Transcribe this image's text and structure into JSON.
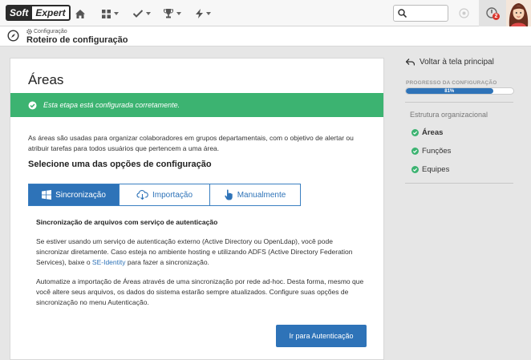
{
  "topbar": {
    "logo_part1": "Soft",
    "logo_part2": "Expert",
    "nav_icons": [
      "home-icon",
      "grid-icon",
      "check-icon",
      "trophy-icon",
      "bolt-icon"
    ],
    "notification_count": "2"
  },
  "subheader": {
    "breadcrumb": "Configuração",
    "title": "Roteiro de configuração"
  },
  "main": {
    "title": "Áreas",
    "alert": "Esta etapa está configurada corretamente.",
    "description": "As áreas são usadas para organizar colaboradores em grupos departamentais, com o objetivo de alertar ou atribuir tarefas para todos usuários que pertencem a uma área.",
    "section_title": "Selecione uma das opções de configuração",
    "tabs": [
      {
        "label": "Sincronização",
        "icon": "windows-icon",
        "active": true
      },
      {
        "label": "Importação",
        "icon": "cloud-download-icon",
        "active": false
      },
      {
        "label": "Manualmente",
        "icon": "hand-pointer-icon",
        "active": false
      }
    ],
    "sync_title": "Sincronização de arquivos com serviço de autenticação",
    "para1_before": "Se estiver usando um serviço de autenticação externo (Active Directory ou OpenLdap), você pode sincronizar diretamente. Caso esteja no ambiente hosting e utilizando ADFS (Active Directory Federation Services), baixe o ",
    "para1_link": "SE-Identity",
    "para1_after": " para fazer a sincronização.",
    "para2": "Automatize a importação de Áreas através de uma sincronização por rede ad-hoc. Desta forma, mesmo que você altere seus arquivos, os dados do sistema estarão sempre atualizados. Configure suas opções de sincronização no menu Autenticação.",
    "button": "Ir para Autenticação"
  },
  "right_panel": {
    "back": "Voltar à tela principal",
    "progress_label": "PROGRESSO DA CONFIGURAÇÃO",
    "progress_text": "81%",
    "progress_value": 0.81,
    "heading": "Estrutura organizacional",
    "items": [
      "Áreas",
      "Funções",
      "Equipes"
    ]
  },
  "colors": {
    "accent": "#2e73b8",
    "success": "#3cb371",
    "badge": "#d9342b"
  }
}
